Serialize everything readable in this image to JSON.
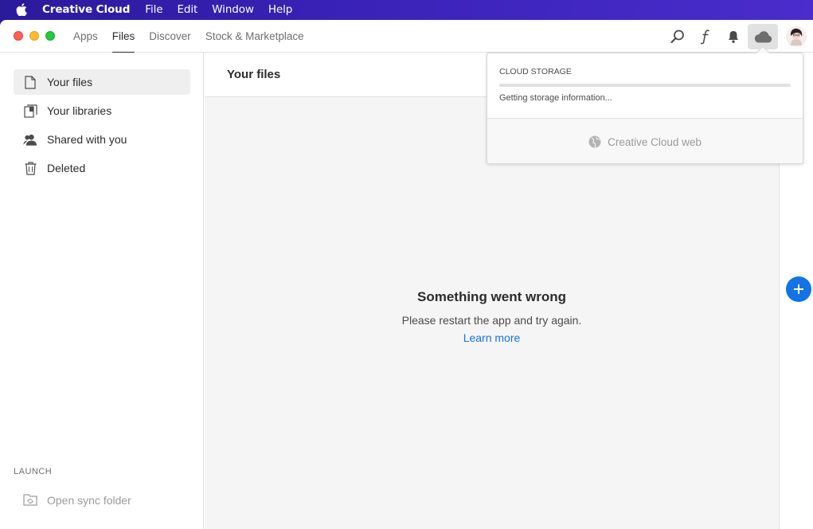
{
  "menubar": {
    "app": "Creative Cloud",
    "items": [
      "File",
      "Edit",
      "Window",
      "Help"
    ]
  },
  "tabs": [
    {
      "label": "Apps",
      "active": false
    },
    {
      "label": "Files",
      "active": true
    },
    {
      "label": "Discover",
      "active": false
    },
    {
      "label": "Stock & Marketplace",
      "active": false
    }
  ],
  "topbar_icons": [
    "search-icon",
    "fonts-icon",
    "bell-icon",
    "cloud-icon",
    "avatar"
  ],
  "sidebar": {
    "items": [
      {
        "label": "Your files",
        "icon": "file-icon",
        "active": true
      },
      {
        "label": "Your libraries",
        "icon": "libraries-icon",
        "active": false
      },
      {
        "label": "Shared with you",
        "icon": "people-icon",
        "active": false
      },
      {
        "label": "Deleted",
        "icon": "trash-icon",
        "active": false
      }
    ],
    "launch_label": "LAUNCH",
    "sync_label": "Open sync folder"
  },
  "main": {
    "title": "Your files",
    "error_title": "Something went wrong",
    "error_message": "Please restart the app and try again.",
    "learn_more": "Learn more"
  },
  "popover": {
    "label": "CLOUD STORAGE",
    "status": "Getting storage information...",
    "usage_fraction": 0,
    "web_link": "Creative Cloud web"
  },
  "colors": {
    "accent": "#1473e6",
    "desktop": "#3a22b8"
  }
}
